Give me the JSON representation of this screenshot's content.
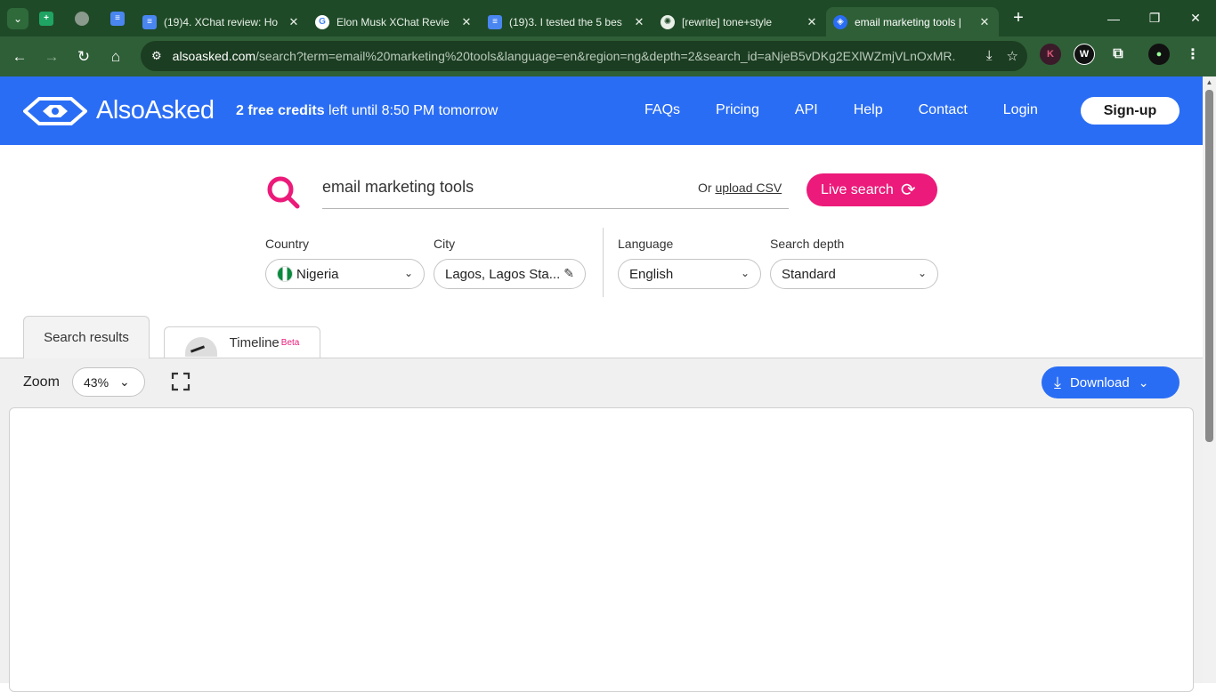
{
  "browser": {
    "tabs": [
      {
        "label": "",
        "icon": "sheets-icon"
      },
      {
        "label": "",
        "icon": "globe-icon"
      },
      {
        "label": "",
        "icon": "docs-icon"
      },
      {
        "label": "(19)4. XChat review: Ho",
        "icon": "docs-icon"
      },
      {
        "label": "Elon Musk XChat Revie",
        "icon": "google-icon"
      },
      {
        "label": "(19)3. I tested the 5 bes",
        "icon": "docs-icon"
      },
      {
        "label": "[rewrite] tone+style",
        "icon": "chatgpt-icon"
      },
      {
        "label": "email marketing tools |",
        "icon": "alsoasked-icon",
        "active": true
      }
    ],
    "url_host": "alsoasked.com",
    "url_path": "/search?term=email%20marketing%20tools&language=en&region=ng&depth=2&search_id=aNjeB5vDKg2EXlWZmjVLnOxMR..."
  },
  "header": {
    "logo_text": "AlsoAsked",
    "credits_bold": "2 free credits",
    "credits_rest": " left until 8:50 PM tomorrow",
    "nav": [
      "FAQs",
      "Pricing",
      "API",
      "Help",
      "Contact",
      "Login"
    ],
    "signup_label": "Sign-up"
  },
  "search": {
    "query": "email marketing tools",
    "or_text": "Or ",
    "upload_label": "upload CSV",
    "live_label": "Live search"
  },
  "filters": {
    "country_label": "Country",
    "country_value": "Nigeria",
    "city_label": "City",
    "city_value": "Lagos, Lagos Sta...",
    "language_label": "Language",
    "language_value": "English",
    "depth_label": "Search depth",
    "depth_value": "Standard"
  },
  "tabs": {
    "results_label": "Search results",
    "timeline_label": "Timeline",
    "timeline_badge": "Beta"
  },
  "controls": {
    "zoom_label": "Zoom",
    "zoom_value": "43%",
    "download_label": "Download"
  },
  "colors": {
    "brand_blue": "#2a6df5",
    "accent_pink": "#ec1a7a",
    "browser_green": "#2f5f37"
  }
}
